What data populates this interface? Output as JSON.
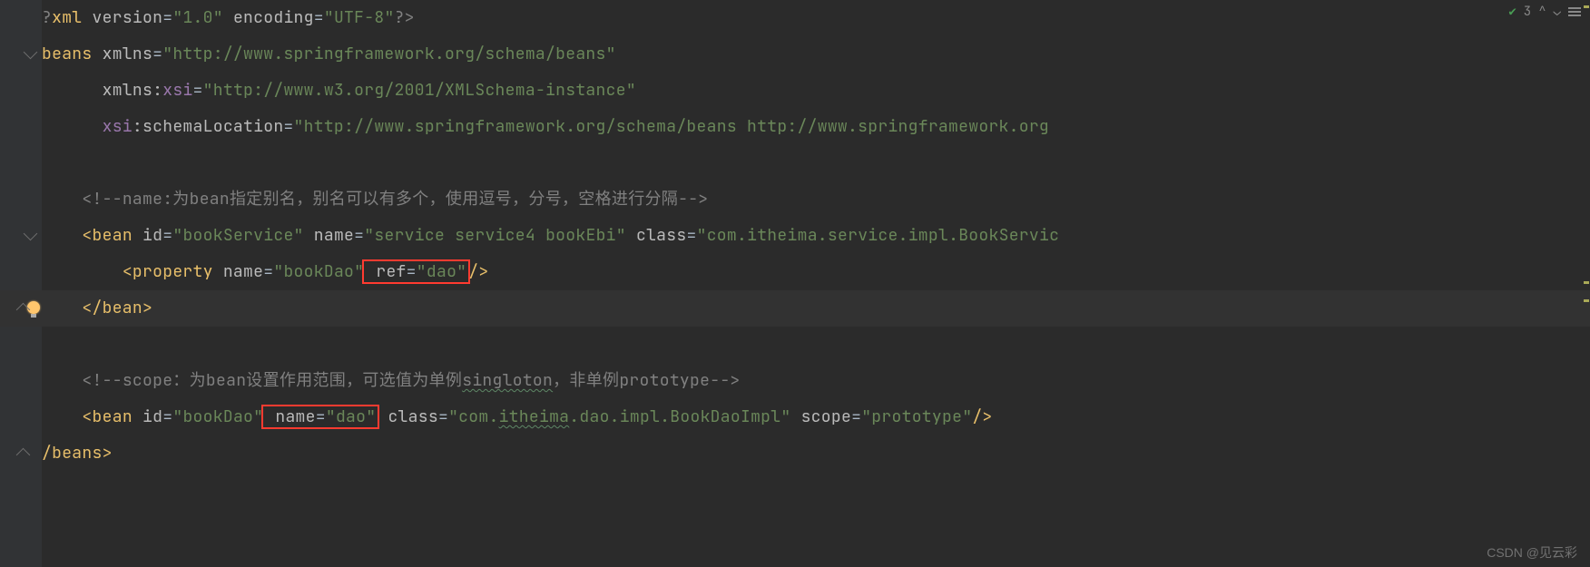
{
  "topRight": {
    "checkGlyph": "✔",
    "count": "3",
    "up": "^",
    "down": "⌄"
  },
  "watermark": "CSDN @见云彩",
  "code": {
    "l1": {
      "pi_open": "?",
      "tag": "xml",
      "a1": " version",
      "eq": "=",
      "v1": "\"1.0\"",
      "a2": " encoding",
      "v2": "\"UTF-8\"",
      "pi_close": "?>"
    },
    "l2": {
      "tag": "beans",
      "a1": " xmlns",
      "eq": "=",
      "v1": "\"http://www.springframework.org/schema/beans\""
    },
    "l3": {
      "pad": "      ",
      "pre": "xmlns:",
      "ns": "xsi",
      "eq": "=",
      "v": "\"http://www.w3.org/2001/XMLSchema-instance\""
    },
    "l4": {
      "pad": "      ",
      "ns": "xsi",
      "attr": ":schemaLocation",
      "eq": "=",
      "v": "\"http://www.springframework.org/schema/beans http://www.springframework.org"
    },
    "l5": {},
    "l6": {
      "pad": "    ",
      "open": "<!--",
      "txt": "name:为bean指定别名，别名可以有多个，使用逗号，分号，空格进行分隔",
      "close": "-->"
    },
    "l7": {
      "pad": "    ",
      "lt": "<",
      "tag": "bean",
      "a1": " id",
      "eq": "=",
      "v1": "\"bookService\"",
      "a2": " name",
      "v2": "\"service service4 bookEbi\"",
      "a3": " class",
      "v3": "\"com.itheima.service.impl.BookServic"
    },
    "l8": {
      "pad": "        ",
      "lt": "<",
      "tag": "property",
      "a1": " name",
      "eq": "=",
      "v1": "\"bookDao\"",
      "box_a": " ref",
      "box_eq": "=",
      "box_v": "\"dao\"",
      "close": "/>"
    },
    "l9": {
      "pad": "    ",
      "lt": "</",
      "tag": "bean",
      "gt": ">"
    },
    "l10": {},
    "l11": {
      "pad": "    ",
      "open": "<!--",
      "txt1": "scope：为bean设置作用范围，可选值为单例",
      "wavy1": "singloton",
      "txt2": "，非单例prototype",
      "close": "-->"
    },
    "l12": {
      "pad": "    ",
      "lt": "<",
      "tag": "bean",
      "a1": " id",
      "eq": "=",
      "v1": "\"bookDao\"",
      "box_a": " name",
      "box_eq": "=",
      "box_v": "\"dao\"",
      "a3": " class",
      "v3_pre": "\"com.",
      "v3_wavy": "itheima",
      "v3_post": ".dao.impl.BookDaoImpl\"",
      "a4": " scope",
      "v4": "\"prototype\"",
      "close": "/>"
    },
    "l13": {
      "tag": "/beans",
      "gt": ">"
    }
  }
}
